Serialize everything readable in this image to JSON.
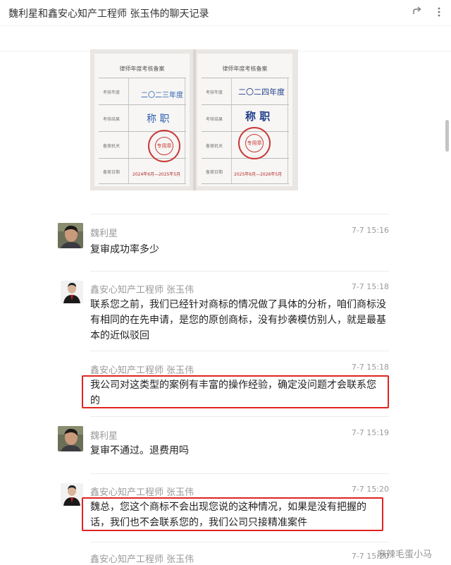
{
  "window": {
    "title": "魏利星和鑫安心知产工程师 张玉伟的聊天记录",
    "share_icon": "share-icon",
    "more_icon": "more-icon"
  },
  "certificate": {
    "left_page": {
      "heading": "律师年度考核备案",
      "rows": [
        "考核年度",
        "考核结果",
        "备案机关",
        "备案日期"
      ],
      "year": "二〇二三年度",
      "result": "称 职",
      "seal": "专用章",
      "date": "2024年6月—2025年5月"
    },
    "right_page": {
      "heading": "律师年度考核备案",
      "rows": [
        "考核年度",
        "考核结果",
        "备案机关",
        "备案日期"
      ],
      "year": "二〇二四年度",
      "result": "称 职",
      "seal": "专用章",
      "date": "2025年6月—2026年5月"
    }
  },
  "messages": [
    {
      "sender": "魏利星",
      "time": "7-7 15:16",
      "text": "复审成功率多少",
      "highlighted": false
    },
    {
      "sender": "鑫安心知产工程师 张玉伟",
      "time": "7-7 15:18",
      "text": "联系您之前，我们已经针对商标的情况做了具体的分析，咱们商标没有相同的在先申请，是您的原创商标，没有抄袭模仿别人，就是最基本的近似驳回",
      "highlighted": false
    },
    {
      "sender": "鑫安心知产工程师 张玉伟",
      "time": "7-7 15:18",
      "text": "我公司对这类型的案例有丰富的操作经验，确定没问题才会联系您的",
      "highlighted": true
    },
    {
      "sender": "魏利星",
      "time": "7-7 15:19",
      "text": "复审不通过。退费用吗",
      "highlighted": false
    },
    {
      "sender": "鑫安心知产工程师 张玉伟",
      "time": "7-7 15:20",
      "text": "魏总，您这个商标不会出现您说的这种情况，如果是没有把握的话，我们也不会联系您的，我们公司只接精准案件",
      "highlighted": true
    },
    {
      "sender": "鑫安心知产工程师 张玉伟",
      "time": "7-7 15:20",
      "text": "",
      "highlighted": false
    }
  ],
  "watermark": "麻辣毛蛋小马",
  "colors": {
    "highlight": "#e0241f",
    "meta_text": "#9a9a9a",
    "seal": "#c93838",
    "ink": "#2e5fb0"
  }
}
